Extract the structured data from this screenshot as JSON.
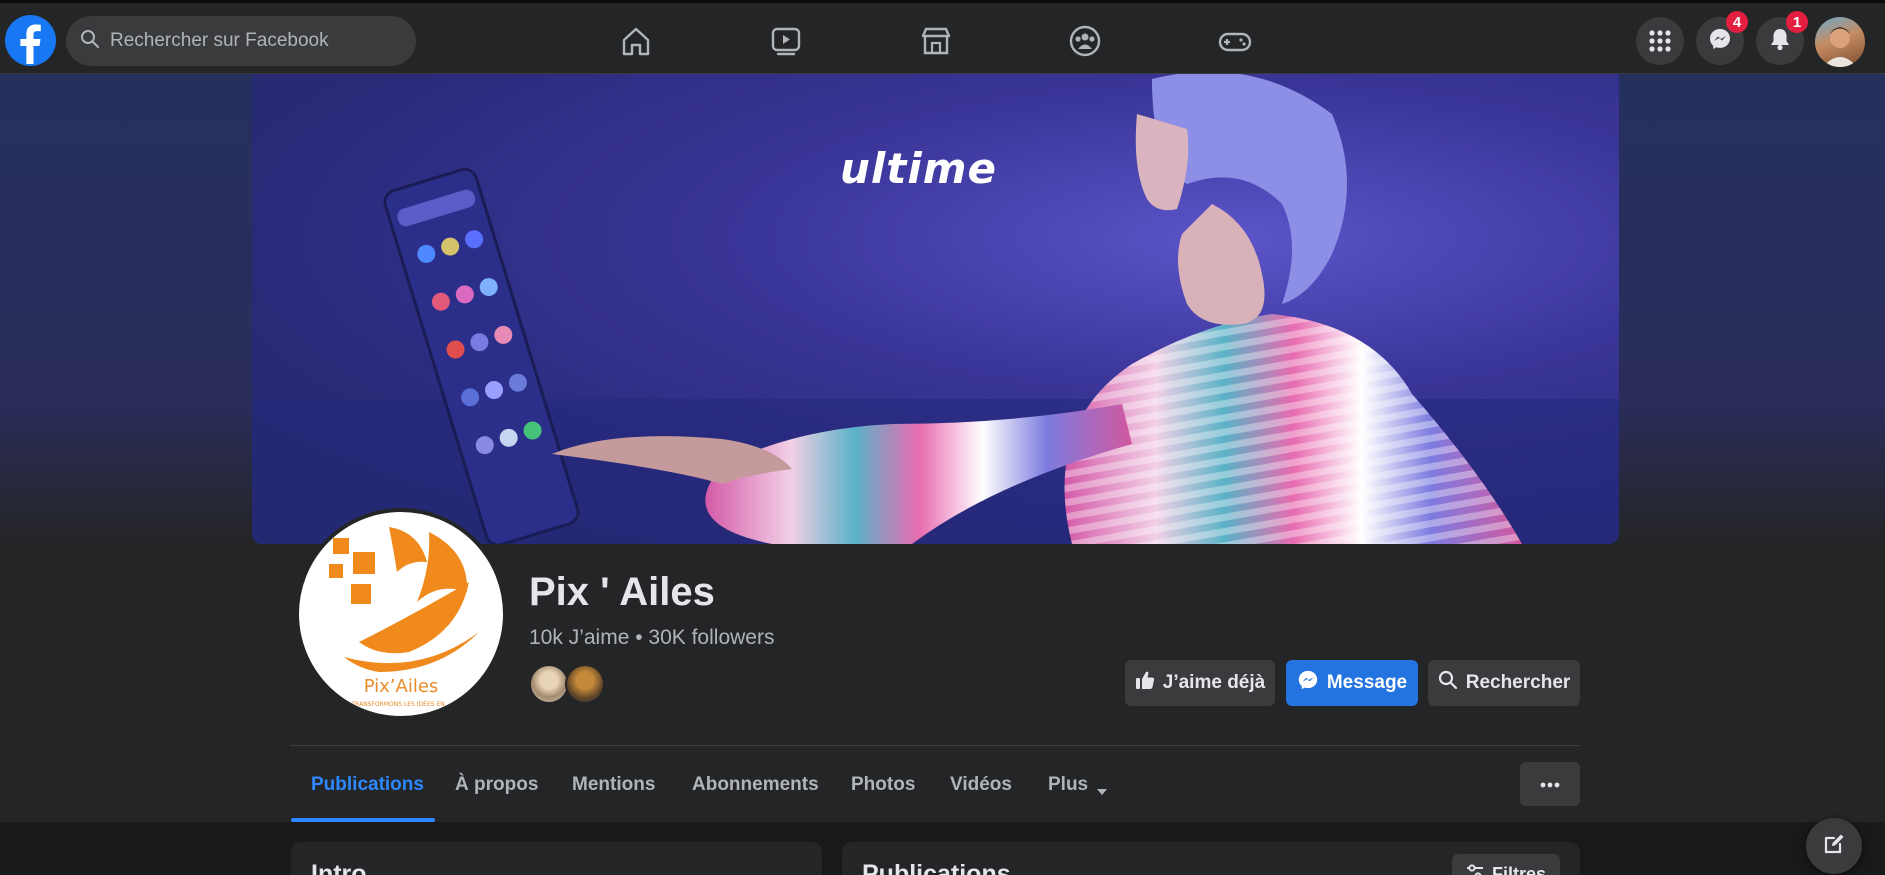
{
  "topbar": {
    "search_placeholder": "Rechercher sur Facebook",
    "nav_icons": [
      "home-icon",
      "watch-icon",
      "marketplace-icon",
      "groups-icon",
      "gaming-icon"
    ],
    "messenger_badge": "4",
    "notifications_badge": "1"
  },
  "cover": {
    "overlay_text": "ultime"
  },
  "profile": {
    "name": "Pix ' Ailes",
    "stats": "10k J’aime • 30K followers",
    "logo_text": "Pix’Ailes",
    "logo_tagline": "TRANSFORMONS LES IDÉES EN..."
  },
  "actions": {
    "liked_label": "J’aime déjà",
    "message_label": "Message",
    "search_label": "Rechercher"
  },
  "tabs": [
    {
      "label": "Publications",
      "active": true
    },
    {
      "label": "À propos"
    },
    {
      "label": "Mentions"
    },
    {
      "label": "Abonnements"
    },
    {
      "label": "Photos"
    },
    {
      "label": "Vidéos"
    },
    {
      "label": "Plus"
    }
  ],
  "intro": {
    "title": "Intro"
  },
  "posts": {
    "title": "Publications",
    "filter_label": "Filtres"
  },
  "colors": {
    "accent": "#2d88ff",
    "primary_button": "#2374e1",
    "badge": "#e41e3f",
    "background": "#18191a",
    "surface": "#242526"
  }
}
